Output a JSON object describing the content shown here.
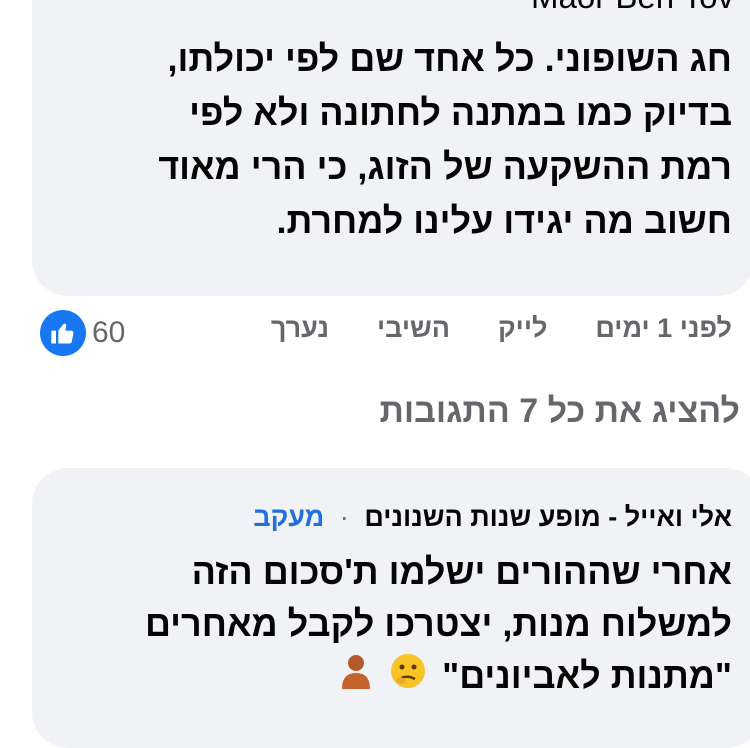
{
  "comment1": {
    "author": "Maor Ben Tov",
    "lines": [
      "חג השופוני. כל אחד שם לפי יכולתו,",
      "בדיוק כמו במתנה לחתונה ולא לפי",
      "רמת ההשקעה של הזוג, כי הרי מאוד",
      "חשוב מה יגידו עלינו למחרת."
    ],
    "time": "לפני 1 ימים",
    "like_label": "לייק",
    "reply_label": "השיבי",
    "edited_label": "נערך",
    "reaction_count": "60",
    "reaction_icon": "like-thumb-icon"
  },
  "view_all_replies": "להציג את כל 7 התגובות",
  "comment2": {
    "author": "אלי ואייל - מופע שנות השנונים",
    "separator": "·",
    "follow_label": "מעקב",
    "lines": [
      "אחרי שההורים ישלמו ת'סכום הזה",
      "למשלוח מנות, יצטרכו לקבל מאחרים",
      "\"מתנות לאביונים\""
    ],
    "emojis": [
      "thinking-face-icon",
      "person-icon"
    ]
  },
  "colors": {
    "bubble": "#f0f2f5",
    "muted": "#65676b",
    "link": "#216fdb",
    "like_blue": "#1877f2"
  }
}
